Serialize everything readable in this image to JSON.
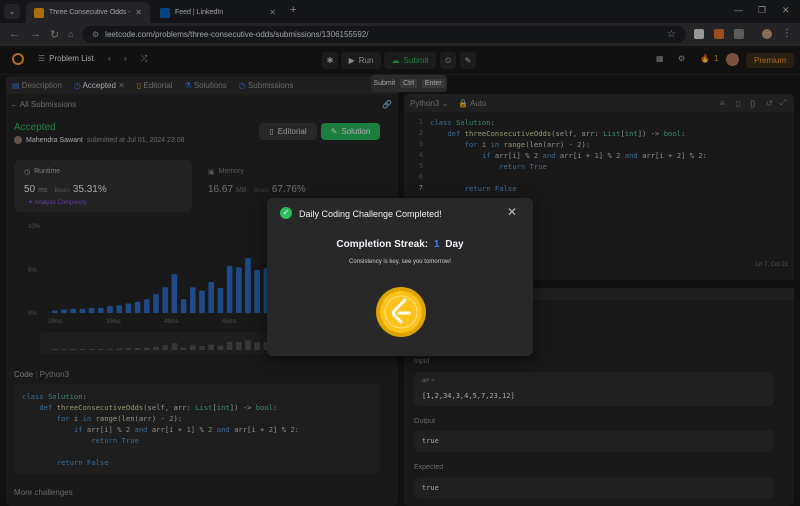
{
  "browser": {
    "tabs": [
      {
        "title": "Three Consecutive Odds - Leet",
        "active": true
      },
      {
        "title": "Feed | LinkedIn",
        "active": false
      }
    ],
    "url": "leetcode.com/problems/three-consecutive-odds/submissions/1306155592/"
  },
  "toolbar": {
    "problem_list": "Problem List",
    "run": "Run",
    "submit": "Submit",
    "streak": "1",
    "premium": "Premium"
  },
  "tooltip": {
    "label": "Submit",
    "key1": "Ctrl",
    "key2": "Enter"
  },
  "left_tabs": [
    "Description",
    "Accepted",
    "Editorial",
    "Solutions",
    "Submissions"
  ],
  "submission": {
    "back": "All Submissions",
    "status": "Accepted",
    "author": "Mahendra Sawant",
    "submitted": "submitted at Jul 01, 2024 23:08",
    "editorial_btn": "Editorial",
    "solution_btn": "Solution",
    "runtime_label": "Runtime",
    "runtime_value": "50",
    "runtime_unit": "ms",
    "runtime_beats_label": "Beats",
    "runtime_beats": "35.31%",
    "analyze": "Analyze Complexity",
    "memory_label": "Memory",
    "memory_value": "16.67",
    "memory_unit": "MB",
    "memory_beats_label": "Beats",
    "memory_beats": "67.76%"
  },
  "chart_data": {
    "type": "bar",
    "y_ticks": [
      "10%",
      "5%",
      "0%"
    ],
    "x_ticks": [
      "29ms",
      "39ms",
      "49ms",
      "45ms"
    ],
    "values": [
      0.3,
      0.4,
      0.5,
      0.5,
      0.6,
      0.6,
      0.8,
      0.9,
      1.1,
      1.3,
      1.6,
      2.2,
      3.0,
      4.5,
      1.6,
      3.0,
      2.6,
      3.6,
      2.9,
      5.5,
      5.3,
      6.4,
      5.0,
      5.2,
      2.2
    ],
    "highlight_index": 19
  },
  "left_code": {
    "header_code": "Code",
    "header_lang": "Python3",
    "lines": [
      "class Solution:",
      "    def threeConsecutiveOdds(self, arr: List[int]) -> bool:",
      "        for i in range(len(arr) - 2):",
      "            if arr[i] % 2 and arr[i + 1] % 2 and arr[i + 2] % 2:",
      "                return True",
      "",
      "        return False"
    ],
    "more": "More challenges"
  },
  "editor": {
    "lang": "Python3",
    "mode": "Auto",
    "cursor": "Ln 7, Col 21",
    "lines": [
      "class Solution:",
      "    def threeConsecutiveOdds(self, arr: List[int]) -> bool:",
      "        for i in range(len(arr) - 2):",
      "            if arr[i] % 2 and arr[i + 1] % 2 and arr[i + 2] % 2:",
      "                return True",
      "",
      "        return False"
    ],
    "line_numbers": [
      "1",
      "2",
      "3",
      "4",
      "5",
      "6",
      "7"
    ]
  },
  "testcase": {
    "input_label": "Input",
    "var_label": "arr =",
    "input_value": "[1,2,34,3,4,5,7,23,12]",
    "output_label": "Output",
    "output_value": "true",
    "expected_label": "Expected",
    "expected_value": "true"
  },
  "modal": {
    "title": "Daily Coding Challenge Completed!",
    "streak_label": "Completion Streak:",
    "streak_value": "1",
    "streak_unit": "Day",
    "message": "Consistency is key, see you tomorrow!"
  },
  "colors": {
    "accent_green": "#2cbb5d",
    "bar_blue": "#2d6fc7",
    "coin_gold": "#ffc21c",
    "brand_orange": "#ffa116"
  }
}
